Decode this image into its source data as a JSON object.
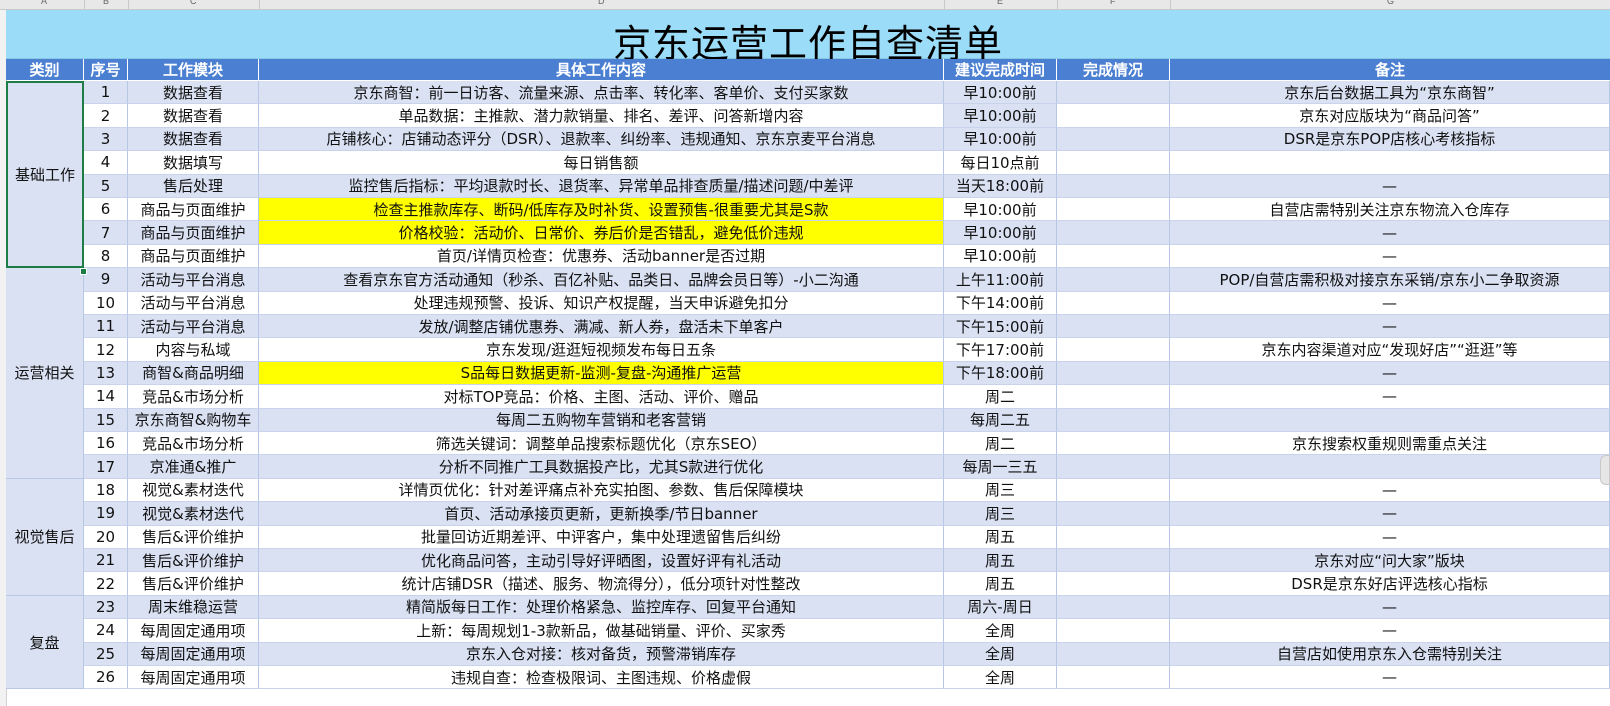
{
  "col_letters": [
    "A",
    "B",
    "C",
    "D",
    "E",
    "F",
    "G"
  ],
  "title": "京东运营工作自查清单",
  "headers": {
    "category": "类别",
    "no": "序号",
    "module": "工作模块",
    "content": "具体工作内容",
    "time": "建议完成时间",
    "status": "完成情况",
    "remark": "备注"
  },
  "categories": [
    {
      "label": "基础工作",
      "rows": 8
    },
    {
      "label": "运营相关",
      "rows": 9
    },
    {
      "label": "视觉售后",
      "rows": 5
    },
    {
      "label": "复盘",
      "rows": 4
    }
  ],
  "rows": [
    {
      "no": "1",
      "module": "数据查看",
      "content": "京东商智：前一日访客、流量来源、点击率、转化率、客单价、支付买家数",
      "time": "早10:00前",
      "status": "",
      "remark": "京东后台数据工具为“京东商智”",
      "highlight": false
    },
    {
      "no": "2",
      "module": "数据查看",
      "content": "单品数据：主推款、潜力款销量、排名、差评、问答新增内容",
      "time": "早10:00前",
      "status": "",
      "remark": "京东对应版块为“商品问答”",
      "highlight": false
    },
    {
      "no": "3",
      "module": "数据查看",
      "content": "店铺核心：店铺动态评分（DSR）、退款率、纠纷率、违规通知、京东京麦平台消息",
      "time": "早10:00前",
      "status": "",
      "remark": "DSR是京东POP店核心考核指标",
      "highlight": false
    },
    {
      "no": "4",
      "module": "数据填写",
      "content": "每日销售额",
      "time": "每日10点前",
      "status": "",
      "remark": "",
      "highlight": false
    },
    {
      "no": "5",
      "module": "售后处理",
      "content": "监控售后指标：平均退款时长、退货率、异常单品排查质量/描述问题/中差评",
      "time": "当天18:00前",
      "status": "",
      "remark": "—",
      "highlight": false
    },
    {
      "no": "6",
      "module": "商品与页面维护",
      "content": "检查主推款库存、断码/低库存及时补货、设置预售-很重要尤其是S款",
      "time": "早10:00前",
      "status": "",
      "remark": "自营店需特别关注京东物流入仓库存",
      "highlight": true
    },
    {
      "no": "7",
      "module": "商品与页面维护",
      "content": "价格校验：活动价、日常价、券后价是否错乱，避免低价违规",
      "time": "早10:00前",
      "status": "",
      "remark": "—",
      "highlight": true
    },
    {
      "no": "8",
      "module": "商品与页面维护",
      "content": "首页/详情页检查：优惠券、活动banner是否过期",
      "time": "早10:00前",
      "status": "",
      "remark": "—",
      "highlight": false
    },
    {
      "no": "9",
      "module": "活动与平台消息",
      "content": "查看京东官方活动通知（秒杀、百亿补贴、品类日、品牌会员日等）-小二沟通",
      "time": "上午11:00前",
      "status": "",
      "remark": "POP/自营店需积极对接京东采销/京东小二争取资源",
      "highlight": false
    },
    {
      "no": "10",
      "module": "活动与平台消息",
      "content": "处理违规预警、投诉、知识产权提醒，当天申诉避免扣分",
      "time": "下午14:00前",
      "status": "",
      "remark": "—",
      "highlight": false
    },
    {
      "no": "11",
      "module": "活动与平台消息",
      "content": "发放/调整店铺优惠券、满减、新人券，盘活未下单客户",
      "time": "下午15:00前",
      "status": "",
      "remark": "—",
      "highlight": false
    },
    {
      "no": "12",
      "module": "内容与私域",
      "content": "京东发现/逛逛短视频发布每日五条",
      "time": "下午17:00前",
      "status": "",
      "remark": "京东内容渠道对应“发现好店”“逛逛”等",
      "highlight": false
    },
    {
      "no": "13",
      "module": "商智&商品明细",
      "content": "S品每日数据更新-监测-复盘-沟通推广运营",
      "time": "下午18:00前",
      "status": "",
      "remark": "—",
      "highlight": true
    },
    {
      "no": "14",
      "module": "竞品&市场分析",
      "content": "对标TOP竞品：价格、主图、活动、评价、赠品",
      "time": "周二",
      "status": "",
      "remark": "—",
      "highlight": false
    },
    {
      "no": "15",
      "module": "京东商智&购物车",
      "content": "每周二五购物车营销和老客营销",
      "time": "每周二五",
      "status": "",
      "remark": "",
      "highlight": false
    },
    {
      "no": "16",
      "module": "竞品&市场分析",
      "content": "筛选关键词：调整单品搜索标题优化（京东SEO）",
      "time": "周二",
      "status": "",
      "remark": "京东搜索权重规则需重点关注",
      "highlight": false
    },
    {
      "no": "17",
      "module": "京准通&推广",
      "content": "分析不同推广工具数据投产比，尤其S款进行优化",
      "time": "每周一三五",
      "status": "",
      "remark": "",
      "highlight": false
    },
    {
      "no": "18",
      "module": "视觉&素材迭代",
      "content": "详情页优化：针对差评痛点补充实拍图、参数、售后保障模块",
      "time": "周三",
      "status": "",
      "remark": "—",
      "highlight": false
    },
    {
      "no": "19",
      "module": "视觉&素材迭代",
      "content": "首页、活动承接页更新，更新换季/节日banner",
      "time": "周三",
      "status": "",
      "remark": "—",
      "highlight": false
    },
    {
      "no": "20",
      "module": "售后&评价维护",
      "content": "批量回访近期差评、中评客户，集中处理遗留售后纠纷",
      "time": "周五",
      "status": "",
      "remark": "—",
      "highlight": false
    },
    {
      "no": "21",
      "module": "售后&评价维护",
      "content": "优化商品问答，主动引导好评晒图，设置好评有礼活动",
      "time": "周五",
      "status": "",
      "remark": "京东对应“问大家”版块",
      "highlight": false
    },
    {
      "no": "22",
      "module": "售后&评价维护",
      "content": "统计店铺DSR（描述、服务、物流得分），低分项针对性整改",
      "time": "周五",
      "status": "",
      "remark": "DSR是京东好店评选核心指标",
      "highlight": false
    },
    {
      "no": "23",
      "module": "周末维稳运营",
      "content": "精简版每日工作：处理价格紧急、监控库存、回复平台通知",
      "time": "周六-周日",
      "status": "",
      "remark": "—",
      "highlight": false
    },
    {
      "no": "24",
      "module": "每周固定通用项",
      "content": "上新：每周规划1-3款新品，做基础销量、评价、买家秀",
      "time": "全周",
      "status": "",
      "remark": "—",
      "highlight": false
    },
    {
      "no": "25",
      "module": "每周固定通用项",
      "content": "京东入仓对接：核对备货，预警滞销库存",
      "time": "全周",
      "status": "",
      "remark": "自营店如使用京东入仓需特别关注",
      "highlight": false
    },
    {
      "no": "26",
      "module": "每周固定通用项",
      "content": "违规自查：检查极限词、主图违规、价格虚假",
      "time": "全周",
      "status": "",
      "remark": "—",
      "highlight": false
    }
  ],
  "colors": {
    "title_bg": "#9bdcf8",
    "header_bg": "#4a7fd1",
    "row_even": "#d9e1f3",
    "row_odd": "#ffffff",
    "highlight": "#ffff00",
    "selection": "#1e7d47"
  }
}
